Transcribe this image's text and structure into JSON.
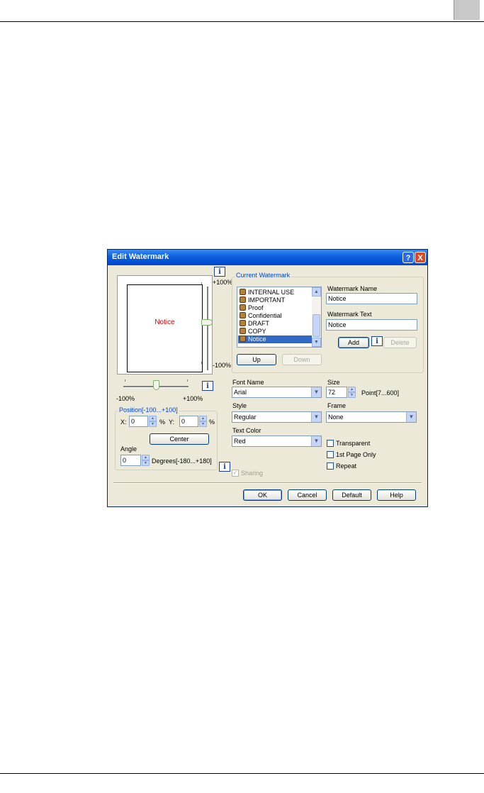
{
  "dialog": {
    "title": "Edit Watermark",
    "help_glyph": "?",
    "close_glyph": "X"
  },
  "preview": {
    "watermark_text": "Notice",
    "vertical_top_label": "+100%",
    "vertical_bottom_label": "-100%",
    "horizontal_left_label": "-100%",
    "horizontal_right_label": "+100%"
  },
  "current_watermark": {
    "group_label": "Current Watermark",
    "items": [
      {
        "label": "INTERNAL USE",
        "selected": false
      },
      {
        "label": "IMPORTANT",
        "selected": false
      },
      {
        "label": "Proof",
        "selected": false
      },
      {
        "label": "Confidential",
        "selected": false
      },
      {
        "label": "DRAFT",
        "selected": false
      },
      {
        "label": "COPY",
        "selected": false
      },
      {
        "label": "Notice",
        "selected": true
      }
    ],
    "up_label": "Up",
    "down_label": "Down",
    "name_label": "Watermark Name",
    "name_value": "Notice",
    "text_label": "Watermark Text",
    "text_value": "Notice",
    "add_label": "Add",
    "delete_label": "Delete"
  },
  "font": {
    "font_name_label": "Font Name",
    "font_name_value": "Arial",
    "size_label": "Size",
    "size_value": "72",
    "size_range": "Point[7...600]",
    "style_label": "Style",
    "style_value": "Regular",
    "frame_label": "Frame",
    "frame_value": "None",
    "text_color_label": "Text Color",
    "text_color_value": "Red"
  },
  "options": {
    "transparent_label": "Transparent",
    "transparent_checked": false,
    "first_page_label": "1st Page Only",
    "first_page_checked": false,
    "repeat_label": "Repeat",
    "repeat_checked": false,
    "sharing_label": "Sharing",
    "sharing_checked": true
  },
  "position": {
    "group_label": "Position[-100...+100]",
    "x_label": "X:",
    "x_value": "0",
    "x_unit": "%",
    "y_label": "Y:",
    "y_value": "0",
    "y_unit": "%",
    "center_label": "Center",
    "angle_label": "Angle",
    "angle_value": "0",
    "angle_range": "Degrees[-180...+180]"
  },
  "footer": {
    "ok_label": "OK",
    "cancel_label": "Cancel",
    "default_label": "Default",
    "help_label": "Help"
  },
  "colors": {
    "title_bar": "#0a5fdc",
    "dialog_bg": "#ece9d8",
    "selection": "#316ac5",
    "watermark_preview": "#d00000",
    "group_label": "#0046d5"
  },
  "info_glyph": "i"
}
